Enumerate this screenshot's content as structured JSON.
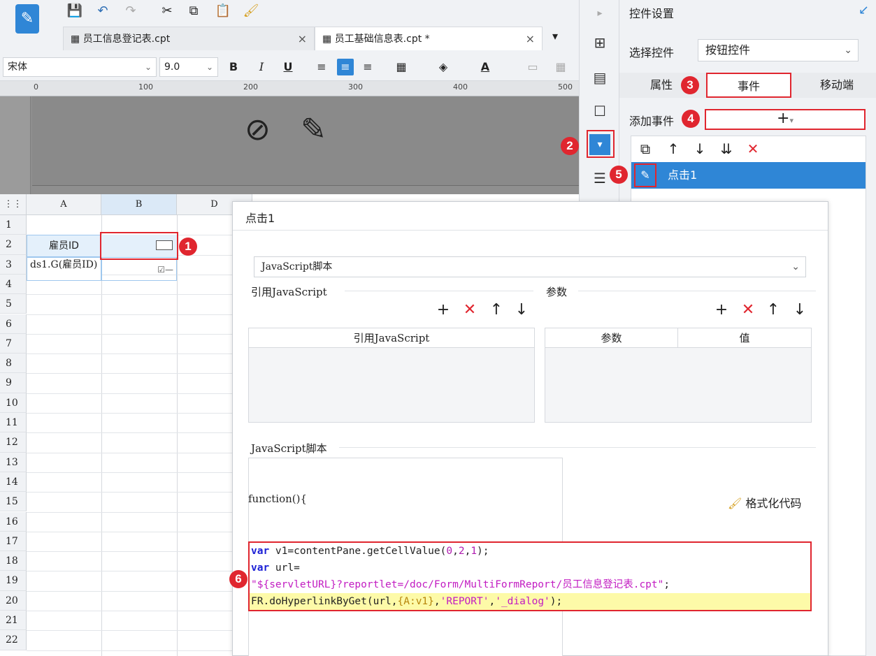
{
  "toolbar": {
    "tabs": [
      {
        "label": "员工信息登记表.cpt",
        "close": "×"
      },
      {
        "label": "员工基础信息表.cpt *",
        "close": "×"
      }
    ],
    "font_name": "宋体",
    "font_size": "9.0",
    "bold": "B",
    "italic": "I",
    "underline": "U",
    "font_color_letter": "A"
  },
  "ruler": {
    "ticks": [
      "0",
      "100",
      "200",
      "300",
      "400",
      "500"
    ]
  },
  "right_panel": {
    "title": "控件设置",
    "select_label": "选择控件",
    "select_value": "按钮控件",
    "tabs": [
      "属性",
      "事件",
      "移动端"
    ],
    "add_event_label": "添加事件",
    "add_symbol": "+",
    "event_item": "点击1"
  },
  "markers": [
    "1",
    "2",
    "3",
    "4",
    "5",
    "6"
  ],
  "sheet": {
    "columns": [
      "A",
      "B",
      "D"
    ],
    "rows": [
      "1",
      "2",
      "3",
      "4",
      "5",
      "6",
      "7",
      "8",
      "9",
      "10",
      "11",
      "12",
      "13",
      "14",
      "15",
      "16",
      "17",
      "18",
      "19",
      "20",
      "21",
      "22"
    ],
    "cell_a2": "雇员ID",
    "cell_a3": "ds1.G(雇员ID)"
  },
  "dialog": {
    "title": "点击1",
    "type_select": "JavaScript脚本",
    "ref_js_section": "引用JavaScript",
    "params_section": "参数",
    "ref_js_header": "引用JavaScript",
    "param_header": "参数",
    "value_header": "值",
    "script_section": "JavaScript脚本",
    "function_text": "function(){",
    "format_code": "格式化代码",
    "code": {
      "line1_kw": "var",
      "line1_a": " v1=contentPane.getCellValue(",
      "line1_n1": "0",
      "line1_c1": ",",
      "line1_n2": "2",
      "line1_c2": ",",
      "line1_n3": "1",
      "line1_end": ");",
      "line2_kw": "var",
      "line2_rest": " url=",
      "line3_str": "\"${servletURL}?reportlet=/doc/Form/MultiFormReport/员工信息登记表.cpt\"",
      "line3_end": ";",
      "line4_a": "FR.doHyperlinkByGet(url,",
      "line4_obj": "{A:v1}",
      "line4_c": ",",
      "line4_s1": "'REPORT'",
      "line4_c2": ",",
      "line4_s2": "'_dialog'",
      "line4_end": ");"
    }
  },
  "colors": {
    "accent": "#2f86d6",
    "marker": "#e0262f",
    "highlight": "#fdfaa8"
  }
}
